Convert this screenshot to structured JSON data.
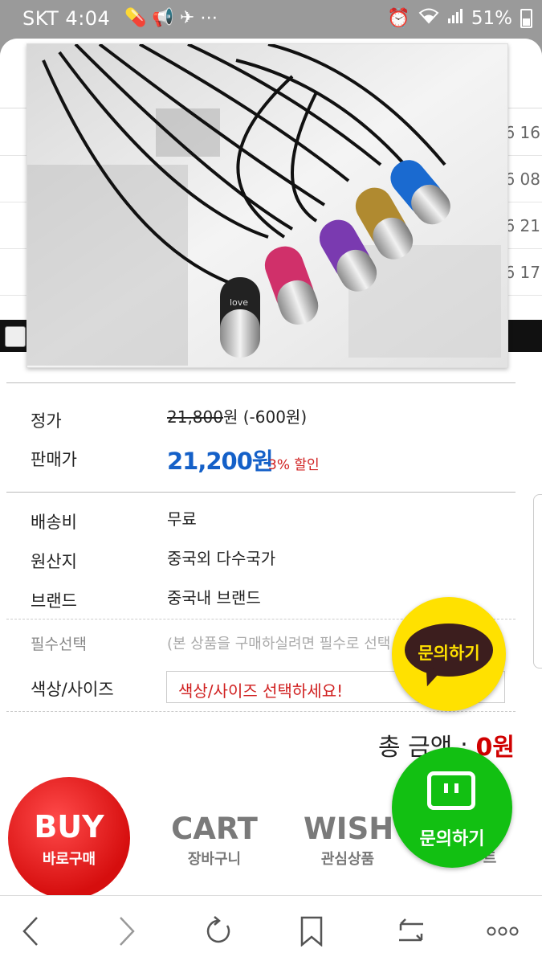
{
  "status_bar": {
    "carrier": "SKT",
    "time": "4:04",
    "battery": "51%",
    "battery_level": 0.51
  },
  "background_rows": [
    "6 16",
    "6 08",
    "6 21",
    "6 17"
  ],
  "product": {
    "list_price_label": "정가",
    "list_price": "21,800",
    "list_price_suffix": "원 (-600원)",
    "sale_price_label": "판매가",
    "sale_price": "21,200원",
    "discount": "3% 할인",
    "shipping_label": "배송비",
    "shipping_value": "무료",
    "origin_label": "원산지",
    "origin_value": "중국외 다수국가",
    "brand_label": "브랜드",
    "brand_value": "중국내 브랜드",
    "required_label": "필수선택",
    "required_note": "(본 상품을 구매하실려면 필수로 선택",
    "option_label": "색상/사이즈",
    "option_placeholder": "색상/사이즈 선택하세요!",
    "total_label": "총 금액 : ",
    "total_value": "0원"
  },
  "actions": {
    "buy_big": "BUY",
    "buy_small": "바로구매",
    "cart_big": "CART",
    "cart_small": "장바구니",
    "wish_big": "WISH",
    "wish_small": "관심상품",
    "hidden_small": "트"
  },
  "floating": {
    "kakao_label": "문의하기",
    "naver_label": "문의하기"
  },
  "colors": {
    "price_blue": "#1460c8",
    "discount_red": "#d02020",
    "kakao_yellow": "#ffe100",
    "naver_green": "#12c012",
    "buy_red": "#e01515"
  }
}
